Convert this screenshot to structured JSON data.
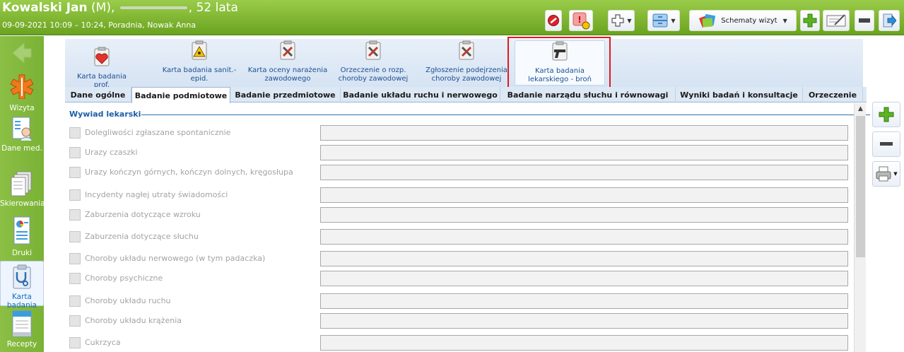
{
  "header": {
    "patient_name": "Kowalski Jan",
    "patient_sex": "(M),",
    "patient_age": ", 52 lata",
    "visit_info": "09-09-2021 10:09 – 10:24, Poradnia, Nowak Anna",
    "toolbar": {
      "schemes_label": "Schematy wizyt"
    }
  },
  "sidebar": {
    "items": [
      {
        "label": "Wizyta",
        "icon": "caduceus-icon"
      },
      {
        "label": "Dane med.",
        "icon": "medical-record-icon"
      },
      {
        "label": "Skierowania",
        "icon": "referrals-icon"
      },
      {
        "label": "Druki",
        "icon": "printouts-icon"
      },
      {
        "label": "Karta badania",
        "icon": "stethoscope-clipboard-icon",
        "active": true
      },
      {
        "label": "Recepty",
        "icon": "prescription-icon"
      }
    ]
  },
  "ribbon": {
    "buttons": [
      {
        "label_1": "Karta badania prof.",
        "label_2": "",
        "icon": "heart-clipboard-icon"
      },
      {
        "label_1": "Karta badania sanit.-",
        "label_2": "epid.",
        "icon": "hazard-clipboard-icon"
      },
      {
        "label_1": "Karta oceny narażenia",
        "label_2": "zawodowego",
        "icon": "tools-clipboard-icon"
      },
      {
        "label_1": "Orzeczenie o rozp.",
        "label_2": "choroby zawodowej",
        "icon": "tools-clipboard-icon"
      },
      {
        "label_1": "Zgłoszenie podejrzenia",
        "label_2": "choroby zawodowej",
        "icon": "tools-clipboard-icon"
      },
      {
        "label_1": "Karta badania",
        "label_2": "lekarskiego - broń",
        "icon": "gun-clipboard-icon",
        "active": true
      }
    ]
  },
  "tabs": [
    {
      "label": "Dane ogólne"
    },
    {
      "label": "Badanie podmiotowe",
      "active": true
    },
    {
      "label": "Badanie przedmiotowe"
    },
    {
      "label": "Badanie układu ruchu i nerwowego"
    },
    {
      "label": "Badanie narządu słuchu i równowagi"
    },
    {
      "label": "Wyniki badań i konsultacje"
    },
    {
      "label": "Orzeczenie"
    }
  ],
  "section": {
    "title": "Wywiad lekarski",
    "rows": [
      {
        "label": "Dolegliwości zgłaszane spontanicznie",
        "value": ""
      },
      {
        "label": "Urazy czaszki",
        "value": ""
      },
      {
        "label": "Urazy kończyn górnych, kończyn dolnych, kręgosłupa",
        "value": ""
      },
      {
        "label": "Incydenty nagłej utraty świadomości",
        "value": ""
      },
      {
        "label": "Zaburzenia dotyczące wzroku",
        "value": ""
      },
      {
        "label": "Zaburzenia dotyczące słuchu",
        "value": ""
      },
      {
        "label": "Choroby układu nerwowego (w tym padaczka)",
        "value": ""
      },
      {
        "label": "Choroby psychiczne",
        "value": ""
      },
      {
        "label": "Choroby układu ruchu",
        "value": ""
      },
      {
        "label": "Choroby układu krążenia",
        "value": ""
      },
      {
        "label": "Cukrzyca",
        "value": ""
      }
    ]
  },
  "colors": {
    "header_green": "#7ab235",
    "label_grey": "#a3a3a3",
    "section_blue": "#1a5fa8",
    "highlight_red": "#e0191f"
  }
}
